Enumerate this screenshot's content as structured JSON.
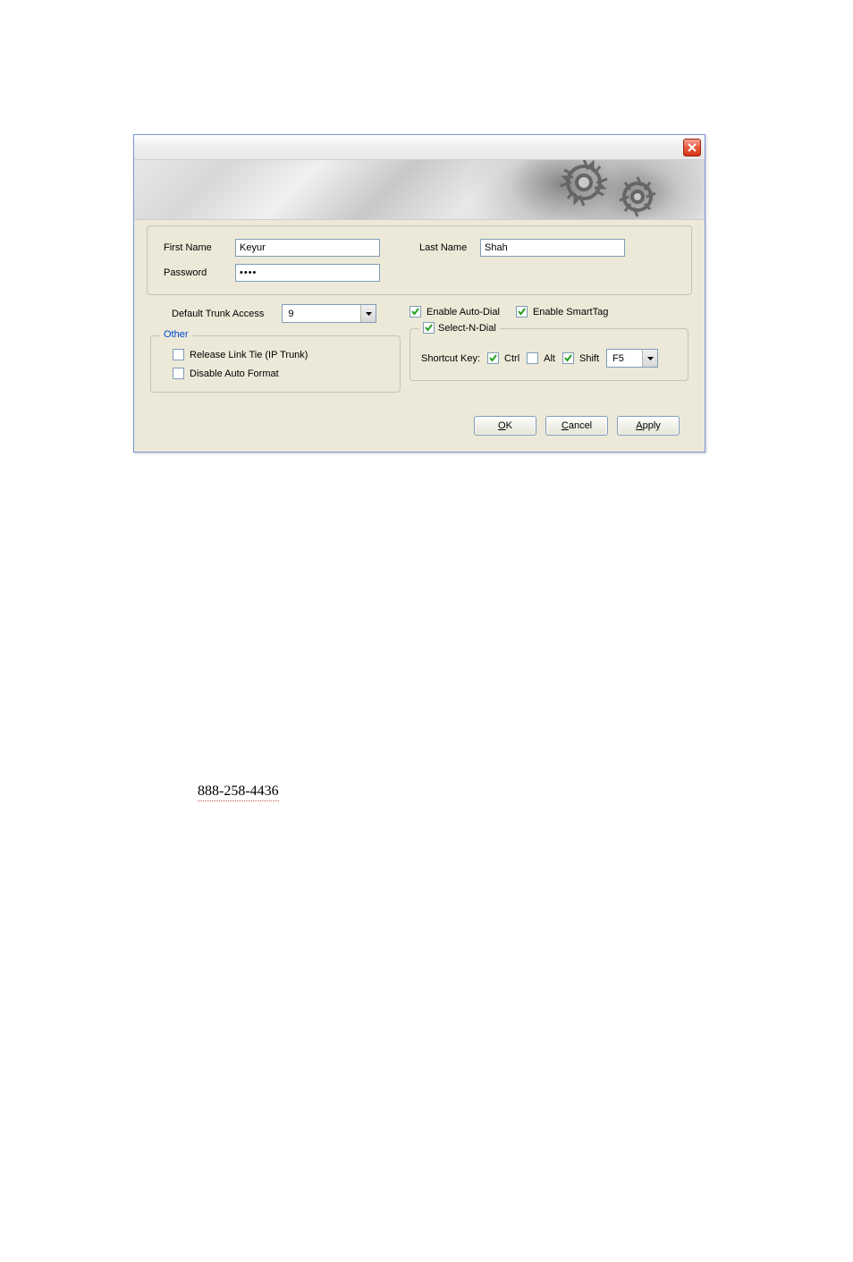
{
  "form": {
    "first_name_label": "First Name",
    "first_name_value": "Keyur",
    "last_name_label": "Last Name",
    "last_name_value": "Shah",
    "password_label": "Password",
    "password_value": "••••"
  },
  "trunk": {
    "label": "Default Trunk Access",
    "value": "9"
  },
  "checkboxes": {
    "enable_auto_dial": "Enable Auto-Dial",
    "enable_smarttag": "Enable SmartTag",
    "release_link": "Release Link Tie (IP Trunk)",
    "disable_auto_format": "Disable Auto Format",
    "select_n_dial": "Select-N-Dial",
    "ctrl": "Ctrl",
    "alt": "Alt",
    "shift": "Shift"
  },
  "fieldsets": {
    "other": "Other",
    "shortcut_label": "Shortcut Key:",
    "shortcut_dropdown": "F5"
  },
  "buttons": {
    "ok_pre": "",
    "ok_u": "O",
    "ok_post": "K",
    "cancel_pre": "",
    "cancel_u": "C",
    "cancel_post": "ancel",
    "apply_pre": "",
    "apply_u": "A",
    "apply_post": "pply"
  },
  "phone": "888-258-4436"
}
